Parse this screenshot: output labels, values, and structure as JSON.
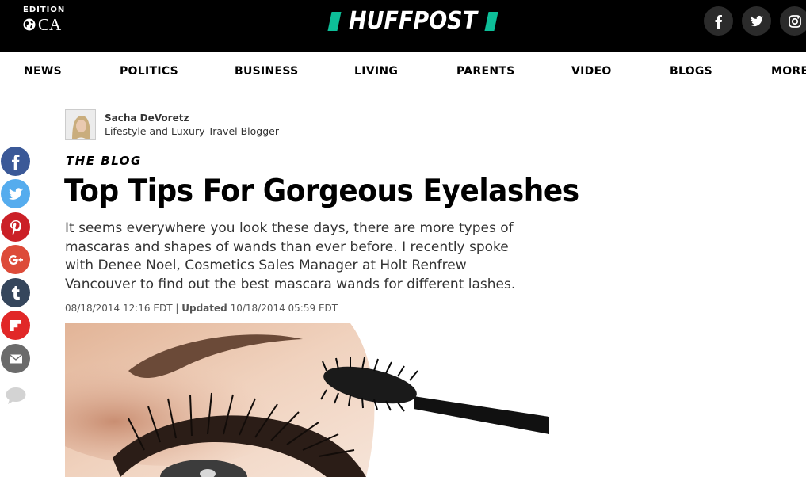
{
  "header": {
    "edition_label": "EDITION",
    "edition_code": "CA",
    "logo_text": "HUFFPOST",
    "brand_color": "#0dbe98",
    "social": [
      {
        "name": "facebook-icon"
      },
      {
        "name": "twitter-icon"
      },
      {
        "name": "instagram-icon"
      }
    ]
  },
  "nav": {
    "items": [
      "NEWS",
      "POLITICS",
      "BUSINESS",
      "LIVING",
      "PARENTS",
      "VIDEO",
      "BLOGS",
      "MORE"
    ]
  },
  "share_bar": [
    {
      "name": "facebook-share",
      "color": "#3b5998"
    },
    {
      "name": "twitter-share",
      "color": "#55acee"
    },
    {
      "name": "pinterest-share",
      "color": "#cb2027"
    },
    {
      "name": "googleplus-share",
      "color": "#dd4b39"
    },
    {
      "name": "tumblr-share",
      "color": "#35465c"
    },
    {
      "name": "flipboard-share",
      "color": "#e12828"
    },
    {
      "name": "email-share",
      "color": "#6b6b6b"
    },
    {
      "name": "comments",
      "color": "#d0d0d0"
    }
  ],
  "article": {
    "author_name": "Sacha DeVoretz",
    "author_role": "Lifestyle and Luxury Travel Blogger",
    "section": "THE BLOG",
    "headline": "Top Tips For Gorgeous Eyelashes",
    "dek": "It seems everywhere you look these days, there are more types of mascaras and shapes of wands than ever before. I recently spoke with Denee Noel, Cosmetics Sales Manager at Holt Renfrew Vancouver to find out the best mascara wands for different lashes.",
    "published": "08/18/2014 12:16 EDT",
    "separator": "|",
    "updated_label": "Updated",
    "updated": "10/18/2014 05:59 EDT"
  }
}
